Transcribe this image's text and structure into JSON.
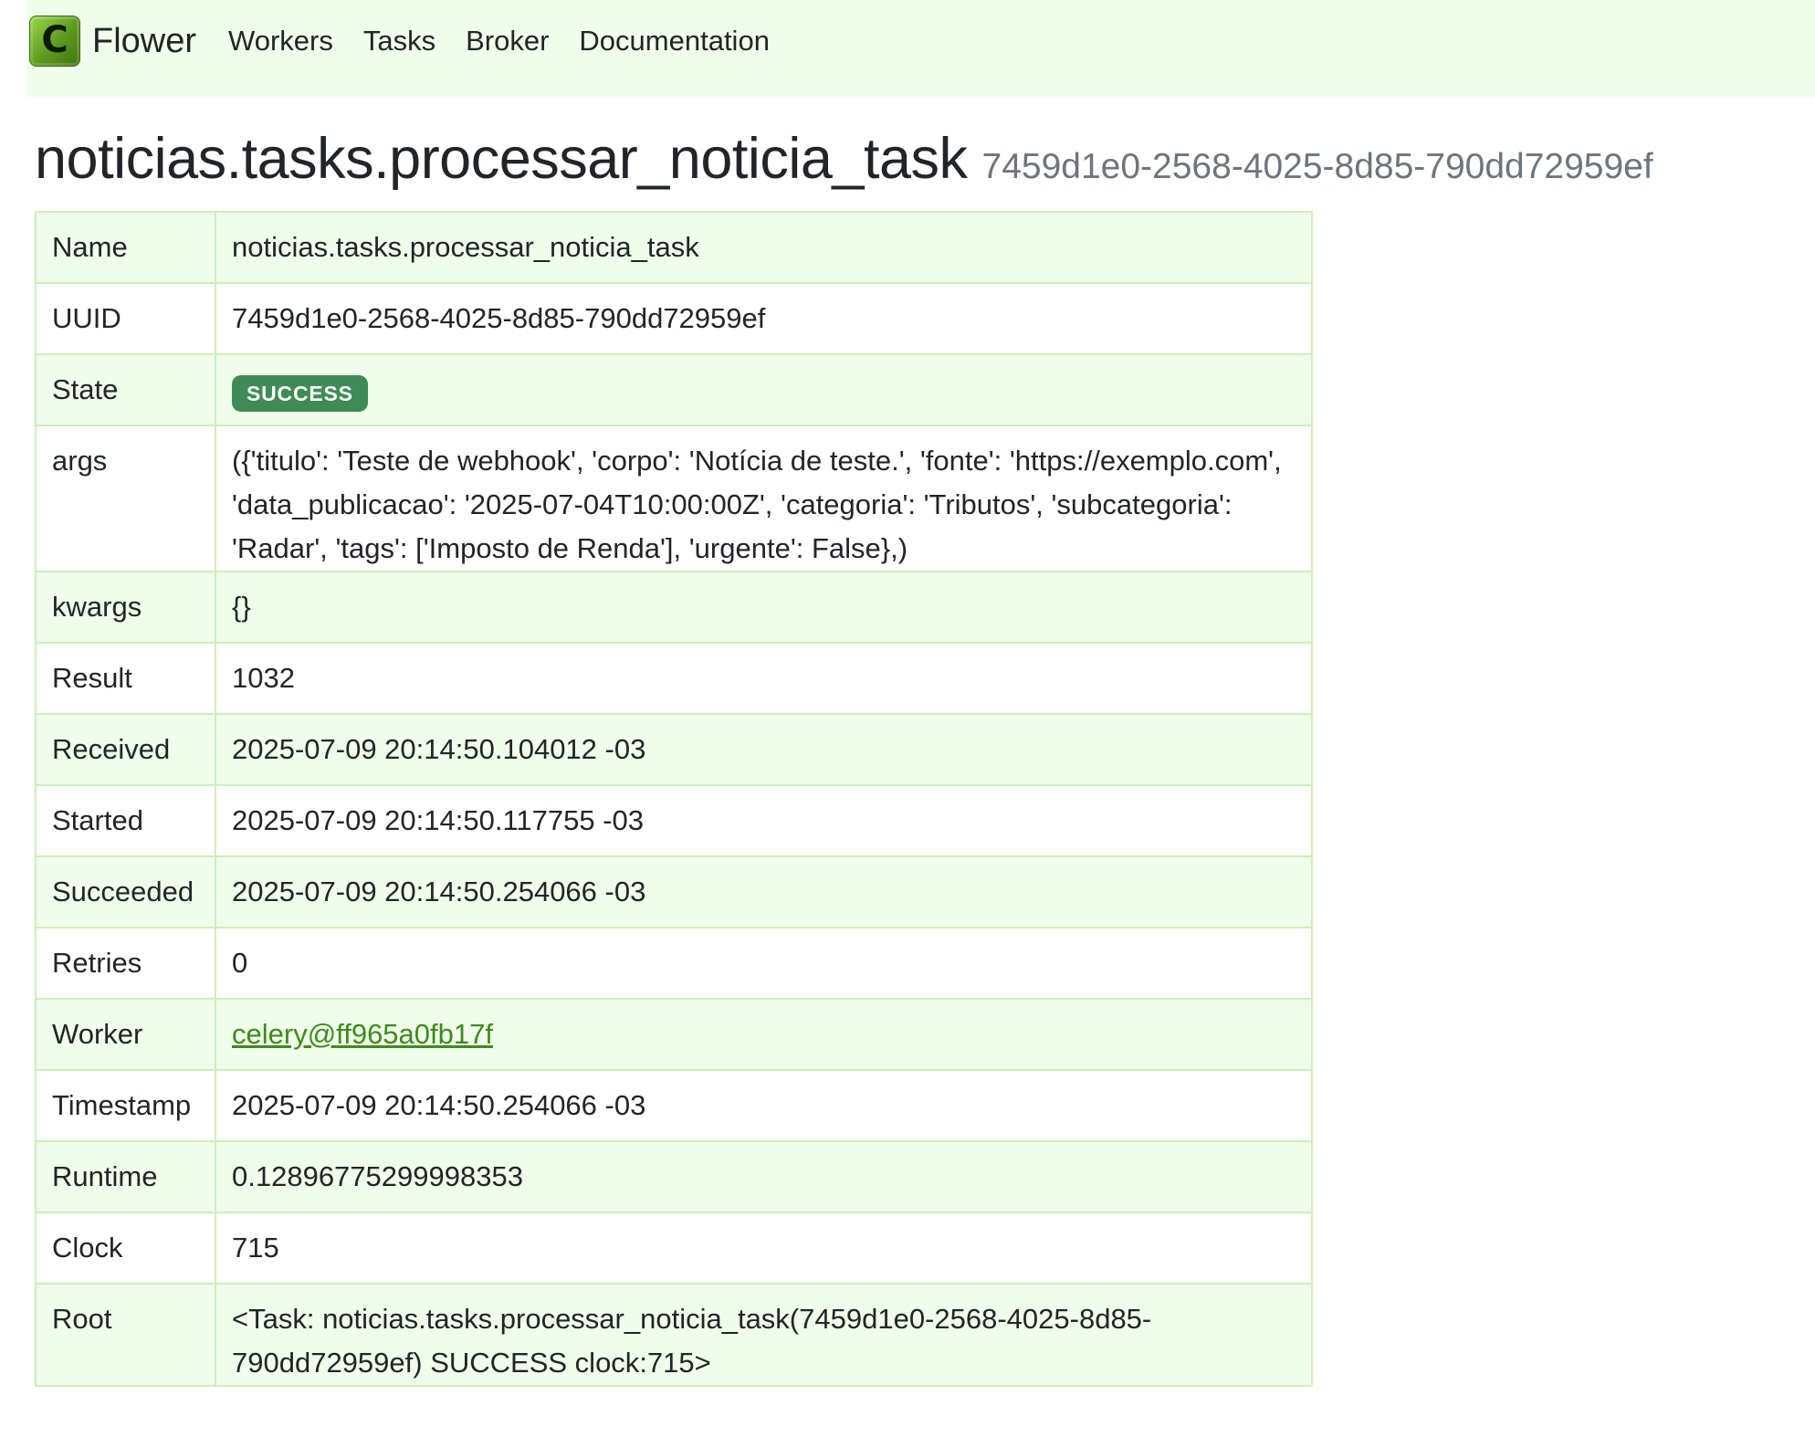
{
  "nav": {
    "brand": "Flower",
    "logo_letter": "C",
    "links": [
      "Workers",
      "Tasks",
      "Broker",
      "Documentation"
    ]
  },
  "task": {
    "title": "noticias.tasks.processar_noticia_task",
    "uuid": "7459d1e0-2568-4025-8d85-790dd72959ef"
  },
  "details": {
    "name": {
      "label": "Name",
      "value": "noticias.tasks.processar_noticia_task"
    },
    "uuid": {
      "label": "UUID",
      "value": "7459d1e0-2568-4025-8d85-790dd72959ef"
    },
    "state": {
      "label": "State",
      "value": "SUCCESS"
    },
    "args": {
      "label": "args",
      "value": "({'titulo': 'Teste de webhook', 'corpo': 'Notícia de teste.', 'fonte': 'https://exemplo.com', 'data_publicacao': '2025-07-04T10:00:00Z', 'categoria': 'Tributos', 'subcategoria': 'Radar', 'tags': ['Imposto de Renda'], 'urgente': False},)"
    },
    "kwargs": {
      "label": "kwargs",
      "value": "{}"
    },
    "result": {
      "label": "Result",
      "value": "1032"
    },
    "received": {
      "label": "Received",
      "value": "2025-07-09 20:14:50.104012 -03"
    },
    "started": {
      "label": "Started",
      "value": "2025-07-09 20:14:50.117755 -03"
    },
    "succeeded": {
      "label": "Succeeded",
      "value": "2025-07-09 20:14:50.254066 -03"
    },
    "retries": {
      "label": "Retries",
      "value": "0"
    },
    "worker": {
      "label": "Worker",
      "value": "celery@ff965a0fb17f"
    },
    "timestamp": {
      "label": "Timestamp",
      "value": "2025-07-09 20:14:50.254066 -03"
    },
    "runtime": {
      "label": "Runtime",
      "value": "0.12896775299998353"
    },
    "clock": {
      "label": "Clock",
      "value": "715"
    },
    "root": {
      "label": "Root",
      "value": "<Task: noticias.tasks.processar_noticia_task(7459d1e0-2568-4025-8d85-790dd72959ef) SUCCESS clock:715>"
    }
  },
  "colors": {
    "navbar_bg": "#f0fdea",
    "row_alt_bg": "#f0fdea",
    "border": "#ccf0b8",
    "success_badge": "#3e8b56",
    "link": "#3d8b1a",
    "muted": "#6c757d"
  }
}
